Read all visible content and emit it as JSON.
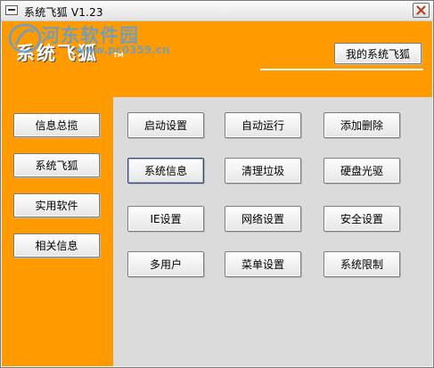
{
  "window": {
    "title": "系统飞狐 V1.23"
  },
  "watermark": {
    "site_name": "河东软件园",
    "url": "www.pc0359.cn"
  },
  "header": {
    "brand_text": "系统飞狐",
    "brand_tm": "TM",
    "about_button": "我的系统飞狐"
  },
  "sidebar": {
    "items": [
      {
        "label": "信息总揽"
      },
      {
        "label": "系统飞狐"
      },
      {
        "label": "实用软件"
      },
      {
        "label": "相关信息"
      }
    ]
  },
  "main": {
    "buttons": [
      {
        "label": "启动设置"
      },
      {
        "label": "自动运行"
      },
      {
        "label": "添加删除"
      },
      {
        "label": "系统信息"
      },
      {
        "label": "清理垃圾"
      },
      {
        "label": "硬盘光驱"
      },
      {
        "label": "IE设置"
      },
      {
        "label": "网络设置"
      },
      {
        "label": "安全设置"
      },
      {
        "label": "多用户"
      },
      {
        "label": "菜单设置"
      },
      {
        "label": "系统限制"
      }
    ],
    "focused_button": "系统信息"
  },
  "colors": {
    "accent_orange": "#ff9b00",
    "panel_gray": "#dbdbdb",
    "watermark_blue": "#5f9ed6"
  }
}
